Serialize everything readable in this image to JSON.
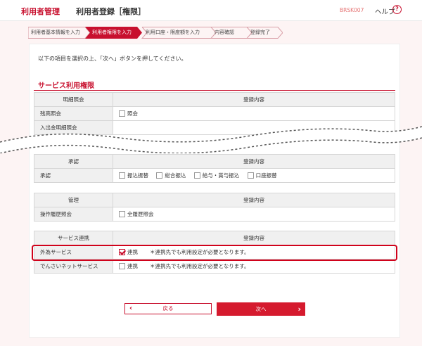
{
  "header": {
    "brand": "利用者管理",
    "title": "利用者登録［権限］",
    "screen_code": "BRSK007",
    "help_label": "ヘルプ",
    "help_icon": "?"
  },
  "steps": [
    {
      "label": "利用者基本情報を入力",
      "active": false
    },
    {
      "label": "利用者権限を入力",
      "active": true
    },
    {
      "label": "利用口座・限度額を入力",
      "active": false
    },
    {
      "label": "内容確認",
      "active": false
    },
    {
      "label": "登録完了",
      "active": false
    }
  ],
  "instruction": "以下の項目を選択の上、「次へ」ボタンを押してください。",
  "section_title": "サービス利用権限",
  "tables": {
    "inquiry": {
      "header_left": "明細照会",
      "header_right": "登録内容",
      "rows": [
        {
          "label": "残高照会",
          "options": [
            "照会"
          ]
        },
        {
          "label": "入出金明細照会",
          "options": []
        }
      ]
    },
    "approval": {
      "header_left": "承認",
      "header_right": "登録内容",
      "row_label": "承認",
      "options": [
        "振込振替",
        "総合振込",
        "給与・賞与振込",
        "口座振替"
      ]
    },
    "management": {
      "header_left": "管理",
      "header_right": "登録内容",
      "row_label": "操作履歴照会",
      "option": "全履歴照会"
    },
    "service": {
      "header_left": "サービス連携",
      "header_right": "登録内容",
      "rows": [
        {
          "label": "外為サービス",
          "option": "連携",
          "note": "＊連携先でも利用設定が必要となります。",
          "checked": true
        },
        {
          "label": "でんさいネットサービス",
          "option": "連携",
          "note": "＊連携先でも利用設定が必要となります。",
          "checked": false
        }
      ]
    }
  },
  "buttons": {
    "back": "戻る",
    "next": "次へ",
    "back_arrow": "‹",
    "next_arrow": "›"
  },
  "colors": {
    "accent": "#c8102e",
    "highlight": "#d0021b"
  }
}
